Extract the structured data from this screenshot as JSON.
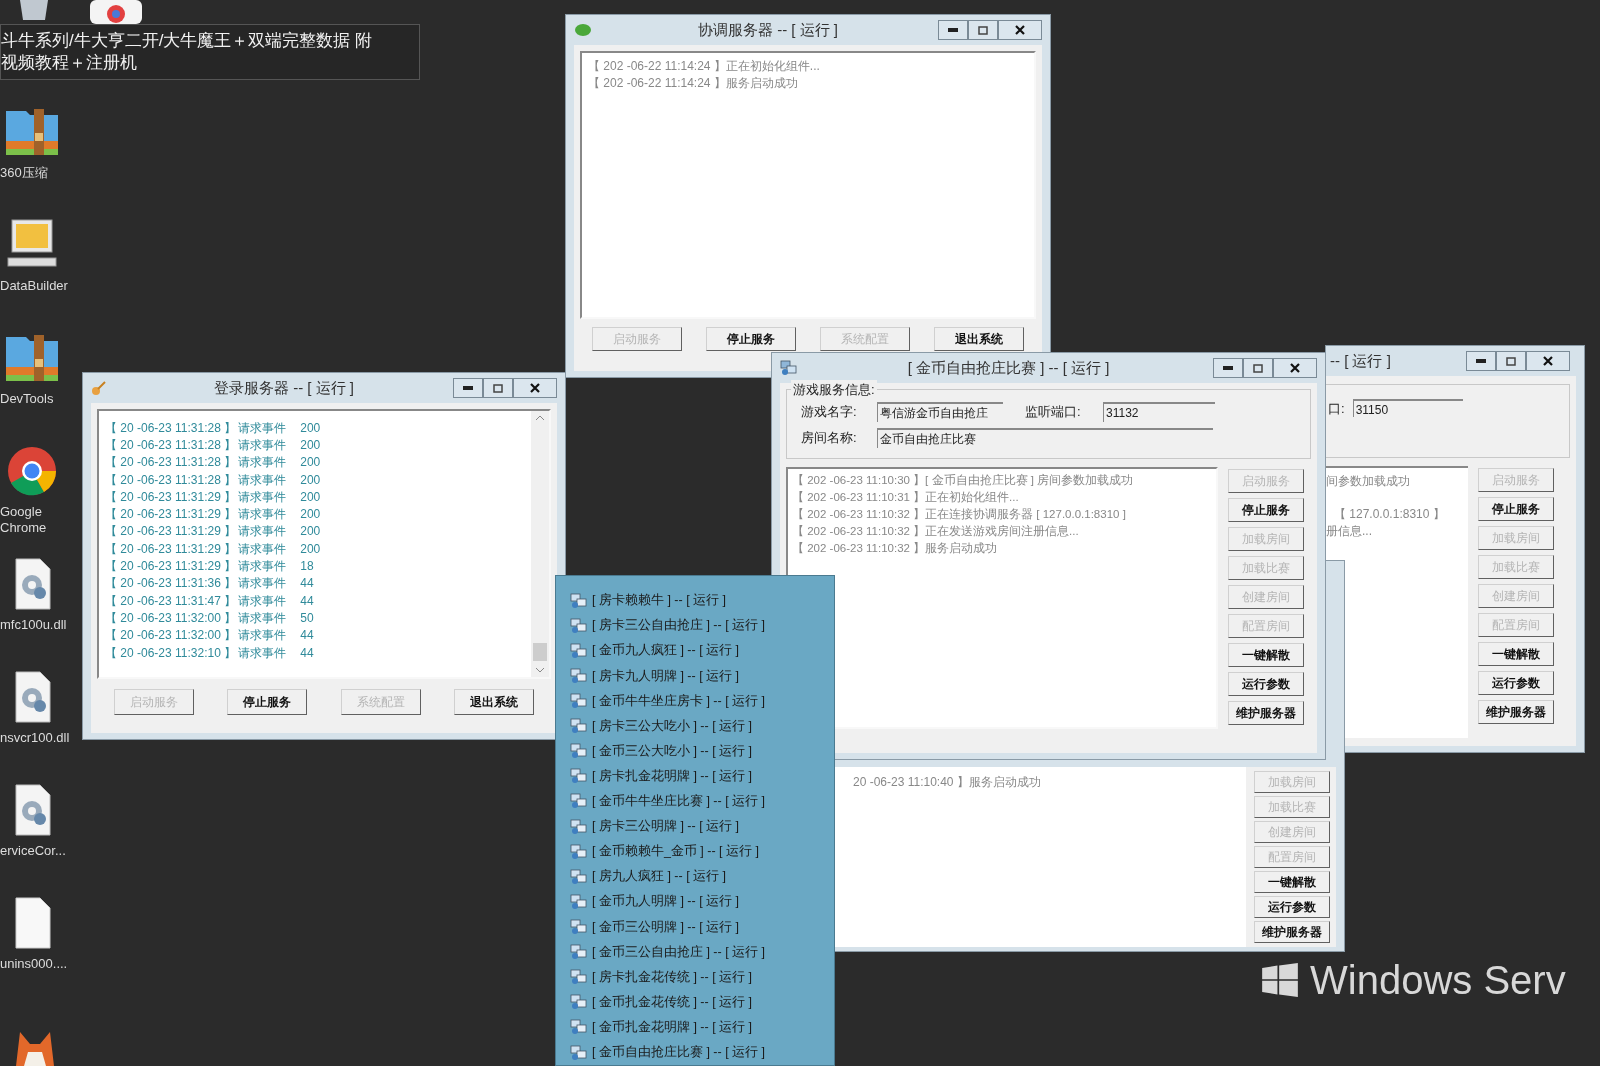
{
  "desktop": {
    "tooltip_lines": [
      "斗牛系列/牛大亨二开/大牛魔王＋双端完整数据 附",
      "视频教程＋注册机"
    ],
    "icons": [
      {
        "label": "360压缩",
        "kind": "zip"
      },
      {
        "label": "DataBuilder",
        "kind": "computer"
      },
      {
        "label": "DevTools",
        "kind": "zip"
      },
      {
        "label": "Google Chrome",
        "kind": "browser"
      },
      {
        "label": "mfc100u.dll",
        "kind": "dll"
      },
      {
        "label": "nsvcr100.dll",
        "kind": "dll"
      },
      {
        "label": "erviceCor...",
        "kind": "dll"
      },
      {
        "label": "unins000....",
        "kind": "file"
      }
    ],
    "wallpaper_text": "Windows Serv"
  },
  "coordinator_window": {
    "title": "协调服务器 -- [ 运行 ]",
    "log": [
      "【 202 -06-22 11:14:24 】正在初始化组件...",
      "【 202 -06-22 11:14:24 】服务启动成功"
    ],
    "buttons": [
      {
        "label": "启动服务",
        "disabled": true
      },
      {
        "label": "停止服务",
        "disabled": false
      },
      {
        "label": "系统配置",
        "disabled": true
      },
      {
        "label": "退出系统",
        "disabled": false
      }
    ]
  },
  "login_window": {
    "title": "登录服务器 -- [ 运行 ]",
    "log": [
      {
        "time": "【 20 -06-23 11:31:28 】",
        "event": "请求事件",
        "code": "200"
      },
      {
        "time": "【 20 -06-23 11:31:28 】",
        "event": "请求事件",
        "code": "200"
      },
      {
        "time": "【 20 -06-23 11:31:28 】",
        "event": "请求事件",
        "code": "200"
      },
      {
        "time": "【 20 -06-23 11:31:28 】",
        "event": "请求事件",
        "code": "200"
      },
      {
        "time": "【 20 -06-23 11:31:29 】",
        "event": "请求事件",
        "code": "200"
      },
      {
        "time": "【 20 -06-23 11:31:29 】",
        "event": "请求事件",
        "code": "200"
      },
      {
        "time": "【 20 -06-23 11:31:29 】",
        "event": "请求事件",
        "code": "200"
      },
      {
        "time": "【 20 -06-23 11:31:29 】",
        "event": "请求事件",
        "code": "200"
      },
      {
        "time": "【 20 -06-23 11:31:29 】",
        "event": "请求事件",
        "code": "18"
      },
      {
        "time": "【 20 -06-23 11:31:36 】",
        "event": "请求事件",
        "code": "44"
      },
      {
        "time": "【 20 -06-23 11:31:47 】",
        "event": "请求事件",
        "code": "44"
      },
      {
        "time": "【 20 -06-23 11:32:00 】",
        "event": "请求事件",
        "code": "50"
      },
      {
        "time": "【 20 -06-23 11:32:00 】",
        "event": "请求事件",
        "code": "44"
      },
      {
        "time": "【 20 -06-23 11:32:10 】",
        "event": "请求事件",
        "code": "44"
      }
    ],
    "buttons": [
      {
        "label": "启动服务",
        "disabled": true
      },
      {
        "label": "停止服务",
        "disabled": false
      },
      {
        "label": "系统配置",
        "disabled": true
      },
      {
        "label": "退出系统",
        "disabled": false
      }
    ]
  },
  "back_game_window": {
    "title": "-- [ 运行 ]",
    "port_label": "口:",
    "port": "31150",
    "log": [
      "间参数加载成功",
      "【 127.0.0.1:8310 】",
      "册信息..."
    ],
    "buttons": [
      {
        "label": "启动服务",
        "disabled": true
      },
      {
        "label": "停止服务",
        "disabled": false
      },
      {
        "label": "加载房间",
        "disabled": true
      },
      {
        "label": "加载比赛",
        "disabled": true
      },
      {
        "label": "创建房间",
        "disabled": true
      },
      {
        "label": "配置房间",
        "disabled": true
      },
      {
        "label": "一键解散",
        "disabled": false
      },
      {
        "label": "运行参数",
        "disabled": false
      },
      {
        "label": "维护服务器",
        "disabled": false
      }
    ]
  },
  "hidden_game_window": {
    "log": [
      "20 -06-23 11:10:40 】服务启动成功"
    ],
    "buttons": [
      {
        "label": "加载房间",
        "disabled": true
      },
      {
        "label": "加载比赛",
        "disabled": true
      },
      {
        "label": "创建房间",
        "disabled": true
      },
      {
        "label": "配置房间",
        "disabled": true
      },
      {
        "label": "一键解散",
        "disabled": false
      },
      {
        "label": "运行参数",
        "disabled": false
      },
      {
        "label": "维护服务器",
        "disabled": false
      }
    ]
  },
  "game_window": {
    "title": "[ 金币自由抢庄比赛 ] -- [ 运行 ]",
    "group_title": "游戏服务信息:",
    "fields": [
      {
        "label": "游戏名字:",
        "value": "粤信游金币自由抢庄"
      },
      {
        "label": "监听端口:",
        "value": "31132"
      },
      {
        "label": "房间名称:",
        "value": "金币自由抢庄比赛"
      }
    ],
    "log": [
      "【 202 -06-23 11:10:30 】[ 金币自由抢庄比赛 ] 房间参数加载成功",
      "【 202 -06-23 11:10:31 】正在初始化组件...",
      "【 202 -06-23 11:10:32 】正在连接协调服务器 [ 127.0.0.1:8310 ]",
      "【 202 -06-23 11:10:32 】正在发送游戏房间注册信息...",
      "【 202 -06-23 11:10:32 】服务启动成功"
    ],
    "buttons": [
      {
        "label": "启动服务",
        "disabled": true
      },
      {
        "label": "停止服务",
        "disabled": false
      },
      {
        "label": "加载房间",
        "disabled": true
      },
      {
        "label": "加载比赛",
        "disabled": true
      },
      {
        "label": "创建房间",
        "disabled": true
      },
      {
        "label": "配置房间",
        "disabled": true
      },
      {
        "label": "一键解散",
        "disabled": false
      },
      {
        "label": "运行参数",
        "disabled": false
      },
      {
        "label": "维护服务器",
        "disabled": false
      }
    ]
  },
  "taskbar_popup": {
    "items": [
      "[ 房卡赖赖牛 ] -- [ 运行 ]",
      "[ 房卡三公自由抢庄 ] -- [ 运行 ]",
      "[ 金币九人疯狂 ] -- [ 运行 ]",
      "[ 房卡九人明牌 ] -- [ 运行 ]",
      "[ 金币牛牛坐庄房卡 ] -- [ 运行 ]",
      "[ 房卡三公大吃小 ] -- [ 运行 ]",
      "[ 金币三公大吃小 ] -- [ 运行 ]",
      "[ 房卡扎金花明牌 ] -- [ 运行 ]",
      "[ 金币牛牛坐庄比赛 ] -- [ 运行 ]",
      "[ 房卡三公明牌 ] -- [ 运行 ]",
      "[ 金币赖赖牛_金币 ] -- [ 运行 ]",
      "[ 房九人疯狂 ] -- [ 运行 ]",
      "[ 金币九人明牌 ] -- [ 运行 ]",
      "[ 金币三公明牌 ] -- [ 运行 ]",
      "[ 金币三公自由抢庄 ] -- [ 运行 ]",
      "[ 房卡扎金花传统 ] -- [ 运行 ]",
      "[ 金币扎金花传统 ] -- [ 运行 ]",
      "[ 金币扎金花明牌 ] -- [ 运行 ]",
      "[ 金币自由抢庄比赛 ] -- [ 运行 ]"
    ]
  }
}
